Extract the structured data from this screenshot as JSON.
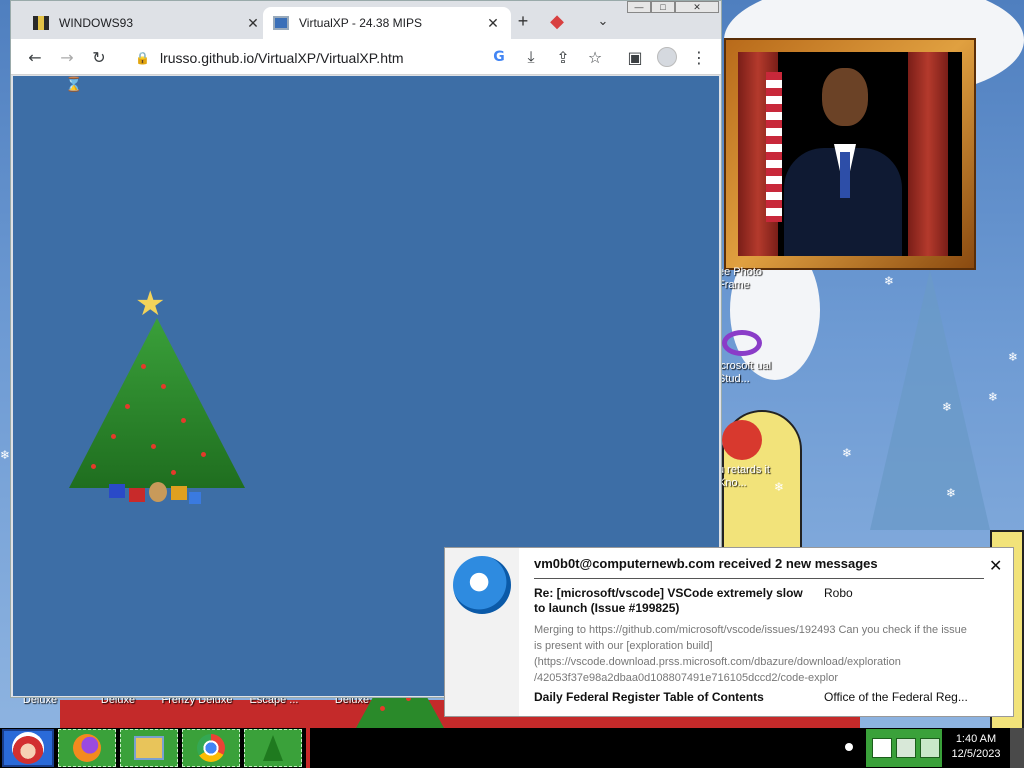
{
  "browser": {
    "tabs": [
      {
        "label": "WINDOWS93",
        "active": false,
        "icon": "windows93-favicon"
      },
      {
        "label": "VirtualXP - 24.38 MIPS",
        "active": true,
        "icon": "monitor-favicon"
      }
    ],
    "new_tab_icon": "plus-icon",
    "url": "lrusso.github.io/VirtualXP/VirtualXP.htm",
    "toolbar_icons": [
      "back-icon",
      "forward-icon",
      "reload-icon",
      "google-icon",
      "install-icon",
      "share-icon",
      "star-icon",
      "side-panel-icon",
      "profile-icon",
      "menu-icon"
    ]
  },
  "desktop": {
    "icons": [
      {
        "label": "ee Photo Frame"
      },
      {
        "label": "icrosoft ual Stud..."
      },
      {
        "label": "u retards it Kno..."
      }
    ],
    "bottom_labels": [
      "Deluxe",
      "Deluxe",
      "Frenzy Deluxe",
      "Escape ...",
      "Deluxe"
    ]
  },
  "notification": {
    "title": "vm0b0t@computernewb.com received 2 new messages",
    "messages": [
      {
        "subject": "Re: [microsoft/vscode] VSCode extremely slow to launch (Issue #199825)",
        "from": "Robo",
        "preview": "Merging to https://github.com/microsoft/vscode/issues/192493 Can you check if the issue is present with our [exploration build] (https://vscode.download.prss.microsoft.com/dbazure/download/exploration /42053f37e98a2dbaa0d108807491e716105dccd2/code-explor"
      },
      {
        "subject": "Daily Federal Register Table of Contents",
        "from": "Office of the Federal Reg..."
      }
    ]
  },
  "taskbar": {
    "clock_time": "1:40 AM",
    "clock_date": "12/5/2023",
    "buttons": [
      "firefox-icon",
      "file-explorer-icon",
      "chrome-icon",
      "christmas-tree-icon"
    ]
  }
}
